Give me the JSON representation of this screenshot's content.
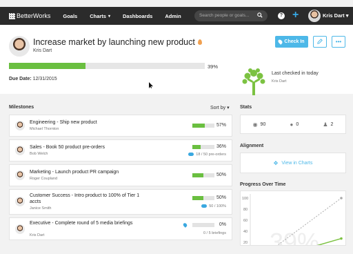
{
  "nav": {
    "logo": "BetterWorks",
    "links": [
      "Goals",
      "Charts",
      "Dashboards",
      "Admin"
    ],
    "search_placeholder": "Search people or goals...",
    "help": "?",
    "add": "+",
    "user": "Kris Dart"
  },
  "goal": {
    "title": "Increase market by launching new product",
    "owner": "Kris Dart",
    "progress_pct": 39,
    "progress_label": "39%",
    "due_label": "Due Date:",
    "due_date": "12/31/2015",
    "checkin_label": "Check In",
    "edit_icon": "pencil-icon",
    "more_label": "•••",
    "last_checked": "Last checked in today",
    "last_checked_user": "Kris Dart"
  },
  "milestones": {
    "heading": "Milestones",
    "sort_label": "Sort by",
    "items": [
      {
        "title": "Engineering - Ship new product",
        "owner": "Michael Thornton",
        "pct": 57,
        "label": "57%",
        "extra": ""
      },
      {
        "title": "Sales - Book 50 product pre-orders",
        "owner": "Bob Welch",
        "pct": 36,
        "label": "36%",
        "extra": "18 / 50 pre-orders"
      },
      {
        "title": "Marketing - Launch product PR campaign",
        "owner": "Roger Coupland",
        "pct": 50,
        "label": "50%",
        "extra": ""
      },
      {
        "title": "Customer Success - Intro product to 100% of Tier 1 accts",
        "owner": "Janice Smith",
        "pct": 50,
        "label": "50%",
        "extra": "50 / 100%"
      },
      {
        "title": "Executive - Complete round of 5 media briefings",
        "owner": "Kris Dart",
        "pct": 0,
        "label": "0%",
        "extra": "0 / 5 briefings"
      }
    ]
  },
  "stats": {
    "heading": "Stats",
    "views": "90",
    "comments": "0",
    "followers": "2"
  },
  "alignment": {
    "heading": "Alignment",
    "link": "View in Charts"
  },
  "chart": {
    "heading": "Progress Over Time",
    "y_ticks": [
      "100",
      "80",
      "60",
      "40",
      "20"
    ],
    "watermark": "39%"
  },
  "chart_data": {
    "type": "line",
    "title": "Progress Over Time",
    "ylim": [
      0,
      100
    ],
    "series": [
      {
        "values": [
          0,
          39
        ]
      },
      {
        "values": [
          0,
          100
        ]
      }
    ]
  },
  "colors": {
    "accent": "#4db8e8",
    "progress": "#6abf40",
    "nav_bg": "#2b2b2b"
  }
}
